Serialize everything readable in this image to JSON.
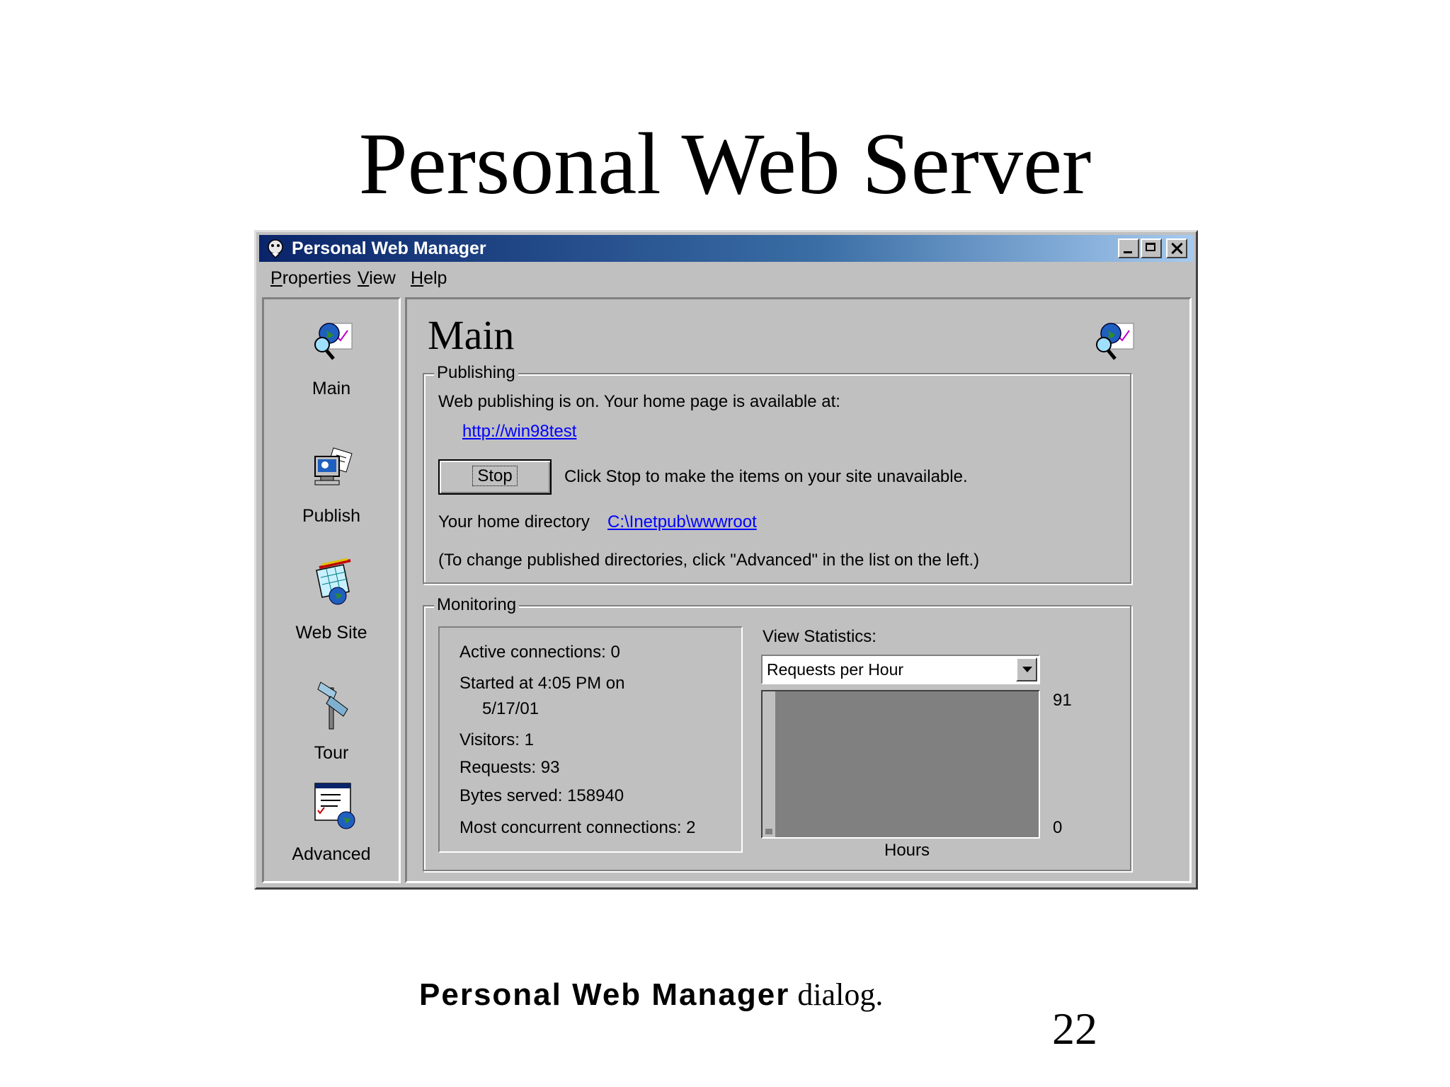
{
  "slide": {
    "title": "Personal Web Server",
    "caption_bold": "Personal Web Manager",
    "caption_rest": " dialog.",
    "page_number": "22"
  },
  "window": {
    "title": "Personal Web Manager",
    "menu": [
      "Properties",
      "View",
      "Help"
    ]
  },
  "sidebar": {
    "items": [
      {
        "label": "Main",
        "icon": "main-globe-magnifier-icon"
      },
      {
        "label": "Publish",
        "icon": "publish-computer-icon"
      },
      {
        "label": "Web Site",
        "icon": "website-wizard-icon"
      },
      {
        "label": "Tour",
        "icon": "tour-signpost-icon"
      },
      {
        "label": "Advanced",
        "icon": "advanced-settings-icon"
      }
    ]
  },
  "main": {
    "title": "Main",
    "publishing": {
      "legend": "Publishing",
      "status_text": "Web publishing is on. Your home page is available at:",
      "home_url": "http://win98test",
      "stop_label": "Stop",
      "stop_hint": "Click Stop to make the items on your site unavailable.",
      "home_dir_label": "Your home directory",
      "home_dir": "C:\\Inetpub\\wwwroot",
      "note": "(To change published directories, click \"Advanced\" in the list on the left.)"
    },
    "monitoring": {
      "legend": "Monitoring",
      "active_connections": "Active connections: 0",
      "started_line1": "Started at 4:05 PM on",
      "started_line2": "5/17/01",
      "visitors": "Visitors:  1",
      "requests": "Requests:  93",
      "bytes_served": "Bytes served: 158940",
      "max_concurrent": "Most concurrent connections: 2",
      "view_stats_label": "View Statistics:",
      "view_stats_value": "Requests per Hour",
      "graph_max": "91",
      "graph_min": "0",
      "graph_xlabel": "Hours"
    }
  },
  "colors": {
    "title_bar_start": "#0a246a",
    "title_bar_end": "#a6caf0",
    "window_face": "#c0c0c0",
    "graph_bg": "#808080",
    "link": "#0000ff"
  }
}
